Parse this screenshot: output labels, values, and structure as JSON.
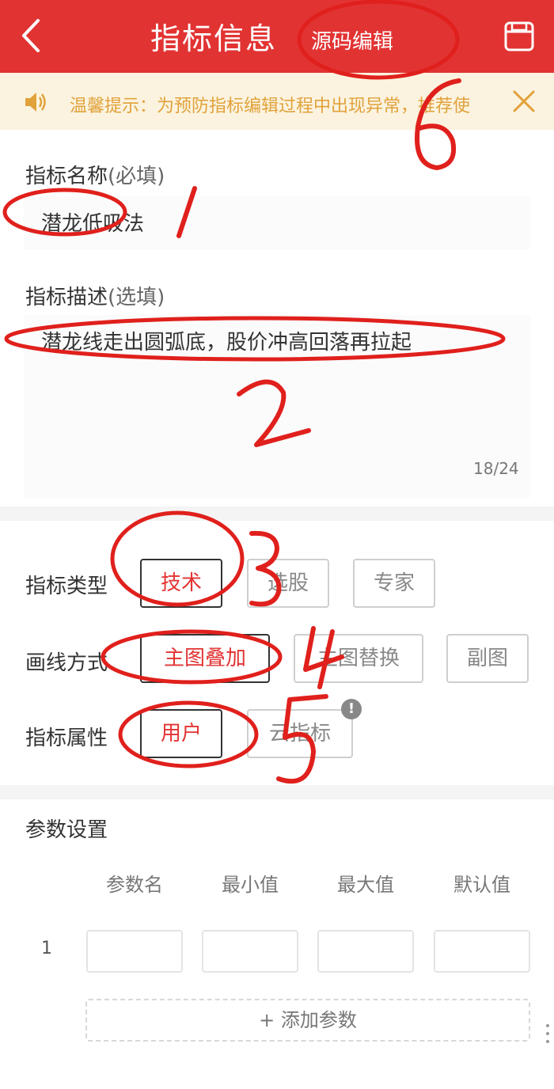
{
  "header": {
    "title": "指标信息",
    "source_edit_label": "源码编辑",
    "colors": {
      "bar": "#e23333",
      "text": "#ffffff"
    }
  },
  "notice": {
    "text": "温馨提示：为预防指标编辑过程中出现异常，推荐使"
  },
  "name_field": {
    "label": "指标名称",
    "hint": "(必填)",
    "value": "潜龙低吸法"
  },
  "desc_field": {
    "label": "指标描述",
    "hint": "(选填)",
    "value": "潜龙线走出圆弧底，股价冲高回落再拉起",
    "count": "18/24"
  },
  "indicator_type": {
    "label": "指标类型",
    "options": [
      "技术",
      "选股",
      "专家"
    ],
    "selected": "技术"
  },
  "draw_mode": {
    "label": "画线方式",
    "options": [
      "主图叠加",
      "主图替换",
      "副图"
    ],
    "selected": "主图叠加"
  },
  "attribute": {
    "label": "指标属性",
    "options": [
      "用户",
      "云指标"
    ],
    "selected": "用户",
    "info_icon": "!"
  },
  "params": {
    "title": "参数设置",
    "columns": [
      "参数名",
      "最小值",
      "最大值",
      "默认值"
    ],
    "rows": [
      {
        "index": "1"
      }
    ],
    "add_label": "+ 添加参数"
  },
  "annotations": {
    "color": "#e0201c",
    "numbers": [
      "1",
      "2",
      "3",
      "4",
      "5",
      "6"
    ]
  },
  "icons": [
    "back-icon",
    "save-icon",
    "speaker-icon",
    "close-icon",
    "info-icon"
  ]
}
